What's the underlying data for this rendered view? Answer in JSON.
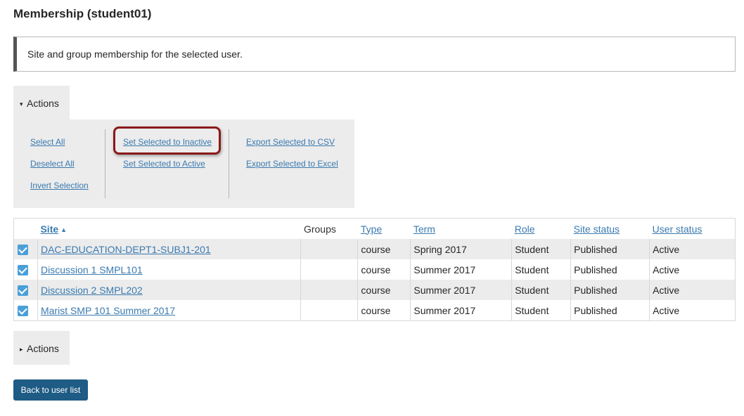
{
  "page": {
    "title": "Membership (student01)"
  },
  "info": {
    "text": "Site and group membership for the selected user."
  },
  "actions_top": {
    "label": "Actions",
    "caret": "▾"
  },
  "actions_bottom": {
    "label": "Actions",
    "caret": "▸"
  },
  "actions": {
    "select_all": "Select All",
    "deselect_all": "Deselect All",
    "invert_selection": "Invert Selection",
    "set_inactive": "Set Selected to Inactive",
    "set_active": "Set Selected to Active",
    "export_csv": "Export Selected to CSV",
    "export_excel": "Export Selected to Excel"
  },
  "table": {
    "headers": {
      "site": "Site",
      "groups": "Groups",
      "type": "Type",
      "term": "Term",
      "role": "Role",
      "site_status": "Site status",
      "user_status": "User status"
    },
    "sort_icon": "sort-ascending-icon",
    "rows": [
      {
        "checked": true,
        "site": "DAC-EDUCATION-DEPT1-SUBJ1-201",
        "groups": "",
        "type": "course",
        "term": "Spring 2017",
        "role": "Student",
        "site_status": "Published",
        "user_status": "Active"
      },
      {
        "checked": true,
        "site": "Discussion 1 SMPL101",
        "groups": "",
        "type": "course",
        "term": "Summer 2017",
        "role": "Student",
        "site_status": "Published",
        "user_status": "Active"
      },
      {
        "checked": true,
        "site": "Discussion 2 SMPL202",
        "groups": "",
        "type": "course",
        "term": "Summer 2017",
        "role": "Student",
        "site_status": "Published",
        "user_status": "Active"
      },
      {
        "checked": true,
        "site": "Marist SMP 101 Summer 2017",
        "groups": "",
        "type": "course",
        "term": "Summer 2017",
        "role": "Student",
        "site_status": "Published",
        "user_status": "Active"
      }
    ]
  },
  "back_button": {
    "label": "Back to user list"
  },
  "colors": {
    "link": "#3a7ab0",
    "button": "#1e5b85",
    "highlight": "#8b1a1a",
    "checkbox": "#4a9fd8"
  }
}
